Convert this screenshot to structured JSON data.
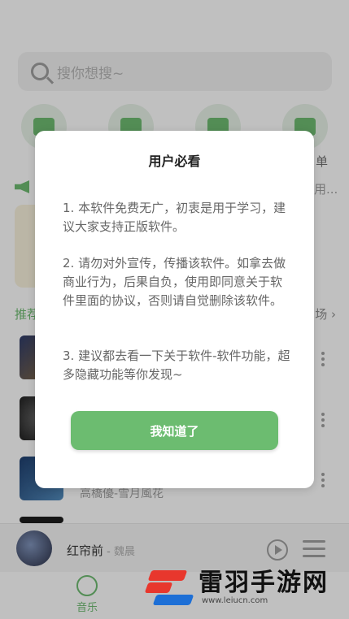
{
  "search": {
    "placeholder": "搜你想搜~"
  },
  "quick": {
    "labels": [
      "单"
    ]
  },
  "notice": {
    "text": "用..."
  },
  "section": {
    "left": "推荐",
    "right": "场"
  },
  "songs": [
    {
      "title": ""
    },
    {
      "title": ""
    },
    {
      "title": "高橋優-雪月風花"
    },
    {
      "title": ""
    }
  ],
  "player": {
    "title": "红帘前",
    "dash": " - ",
    "author": "魏晨"
  },
  "tabs": {
    "music": "音乐"
  },
  "dialog": {
    "title": "用户必看",
    "paragraphs": [
      "1. 本软件免费无广，初衷是用于学习，建议大家支持正版软件。",
      "2. 请勿对外宣传，传播该软件。如拿去做商业行为，后果自负，使用即同意关于软件里面的协议，否则请自觉删除该软件。",
      "3. 建议都去看一下关于软件-软件功能，超多隐藏功能等你发现~"
    ],
    "ok_label": "我知道了"
  },
  "watermark": {
    "name": "雷羽手游网",
    "url": "www.leiucn.com"
  },
  "colors": {
    "accent": "#6cbc70",
    "overlay": "rgba(0,0,0,0.22)"
  }
}
